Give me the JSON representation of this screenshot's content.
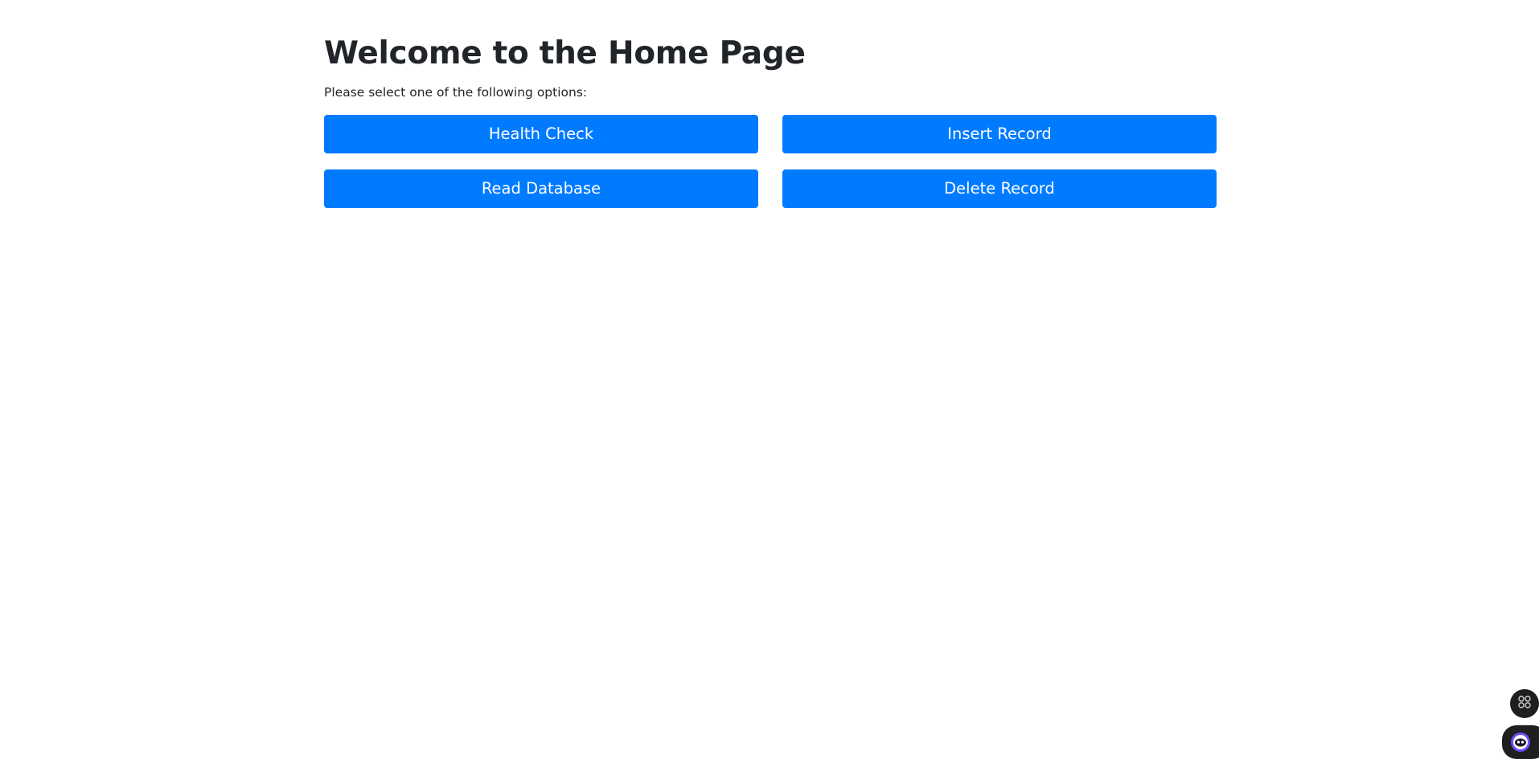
{
  "header": {
    "title": "Welcome to the Home Page",
    "subtitle": "Please select one of the following options:"
  },
  "actions": {
    "health_check": "Health Check",
    "insert_record": "Insert Record",
    "read_database": "Read Database",
    "delete_record": "Delete Record"
  },
  "colors": {
    "primary": "#007bff",
    "text": "#212529",
    "background": "#ffffff"
  },
  "floating_widgets": {
    "apps_icon": "apps-grid-icon",
    "assistant_icon": "assistant-bot-icon"
  }
}
